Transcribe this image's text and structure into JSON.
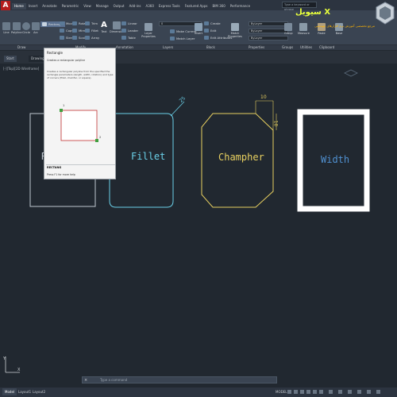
{
  "titlebar": {
    "tabs": [
      "Home",
      "Insert",
      "Annotate",
      "Parametric",
      "View",
      "Manage",
      "Output",
      "Add-ins",
      "A360",
      "Express Tools",
      "Featured Apps",
      "BIM 360",
      "Performance"
    ],
    "search_placeholder": "Type a keyword or phrase"
  },
  "ribbon": {
    "draw_tools": [
      "Line",
      "Polyline",
      "Circle",
      "Arc"
    ],
    "rect_button_label": "Rectangle",
    "modify_rows": [
      [
        "Move",
        "Rotate",
        "Trim"
      ],
      [
        "Copy",
        "Mirror",
        "Fillet"
      ],
      [
        "Stretch",
        "Scale",
        "Array"
      ]
    ],
    "annotation_tools": [
      "Text",
      "Dimension"
    ],
    "annotation_rows": [
      "Linear",
      "Leader",
      "Table"
    ],
    "layer_props_label": "Layer Properties",
    "layer_value": "0",
    "layer_rows": [
      "Make Current",
      "Match Layer"
    ],
    "block_insert": "Insert",
    "block_rows": [
      "Create",
      "Edit",
      "Edit Attributes"
    ],
    "match_props": "Match Properties",
    "prop_values": [
      "ByLayer",
      "ByLayer",
      "ByLayer"
    ],
    "groups_label": "Group",
    "measure_label": "Measure",
    "paste_label": "Paste",
    "base_label": "Base"
  },
  "panels": [
    "Draw",
    "Modify",
    "Annotation",
    "Layers",
    "Block",
    "Properties",
    "Groups",
    "Utilities",
    "Clipboard"
  ],
  "file_tabs": [
    "Start",
    "Drawing1*"
  ],
  "viewport_label": "[-][Top][2D Wireframe]",
  "tooltip": {
    "title": "Rectangle",
    "desc": "Creates a rectangular polyline",
    "desc2": "Creates a rectangular polyline from the specified the rectangle parameters (length, width, rotation) and type of corners (fillet, chamfer, or square).",
    "cmd": "RECTANG",
    "help": "Press F1 for more help",
    "point_labels": [
      "1",
      "2"
    ]
  },
  "drawing": {
    "labels": {
      "rect": "Re",
      "fillet": "Fillet",
      "champher": "Champher",
      "width": "Width"
    },
    "dims": {
      "radius": "25",
      "chamfer_top": "10",
      "chamfer_side": "10"
    },
    "colors": {
      "gray": "#c0c8d0",
      "cyan": "#6ad0e8",
      "yellow": "#e8d060",
      "white": "#ffffff",
      "width_text": "#5090d0"
    }
  },
  "banner": {
    "title": "سیویل X",
    "subtitle": "مرجع تخصصی آموزش نرم افزارهای مهندسی"
  },
  "command_line": {
    "placeholder": "Type a command"
  },
  "status": {
    "tabs": [
      "Model",
      "Layout1",
      "Layout2"
    ],
    "model_label": "MODEL"
  }
}
